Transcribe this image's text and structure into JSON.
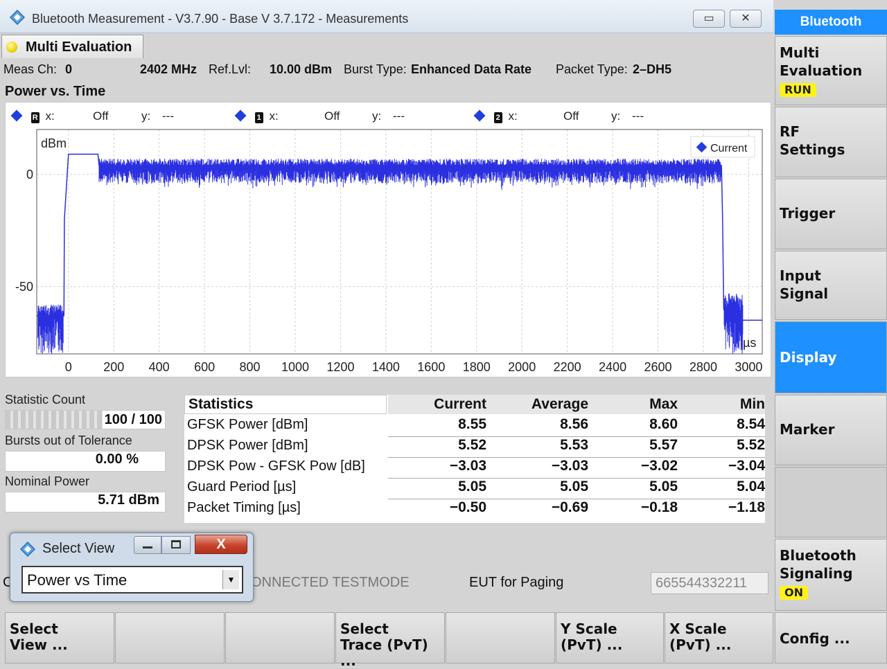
{
  "window": {
    "title": "Bluetooth Measurement  - V3.7.90 - Base V 3.7.172 - Measurements",
    "minimize": "▭",
    "close": "✕"
  },
  "tab": {
    "label": "Multi Evaluation"
  },
  "info": {
    "meas_ch_label": "Meas Ch:",
    "meas_ch": "0",
    "freq": "2402 MHz",
    "ref_lvl_label": "Ref.Lvl:",
    "ref_lvl": "10.00 dBm",
    "burst_label": "Burst Type:",
    "burst": "Enhanced Data Rate",
    "packet_label": "Packet Type:",
    "packet": "2–DH5"
  },
  "plot": {
    "title": "Power vs. Time",
    "markers": [
      {
        "id": "R",
        "x_label": "x:",
        "x": "Off",
        "y_label": "y:",
        "y": "---"
      },
      {
        "id": "1",
        "x_label": "x:",
        "x": "Off",
        "y_label": "y:",
        "y": "---"
      },
      {
        "id": "2",
        "x_label": "x:",
        "x": "Off",
        "y_label": "y:",
        "y": "---"
      }
    ],
    "legend": "Current",
    "ylabel": "dBm",
    "xunit": "µs"
  },
  "chart_data": {
    "type": "line",
    "ylabel": "dBm",
    "xlabel": "µs",
    "xlim": [
      -140,
      3060
    ],
    "ylim": [
      -80,
      20
    ],
    "x_ticks": [
      "0",
      "200",
      "400",
      "600",
      "800",
      "1000",
      "1200",
      "1400",
      "1600",
      "1800",
      "2000",
      "2200",
      "2400",
      "2600",
      "2800",
      "3000"
    ],
    "y_ticks": [
      "0",
      "-50"
    ],
    "series": [
      {
        "name": "Current",
        "x": [
          -140,
          -20,
          -18,
          0,
          2,
          130,
          135,
          2880,
          2885,
          2890,
          2900,
          2950,
          3060
        ],
        "y": [
          -63,
          -63,
          -20,
          9,
          9,
          9,
          4,
          4,
          -20,
          -60,
          -63,
          -65,
          -65
        ]
      }
    ]
  },
  "stats_left": {
    "statistic_count_label": "Statistic Count",
    "statistic_count": "100 / 100",
    "statistic_progress": 1.0,
    "bursts_label": "Bursts out of Tolerance",
    "bursts_value": "0.00  %",
    "nominal_label": "Nominal Power",
    "nominal_value": "5.71  dBm"
  },
  "stats_table": {
    "headers": [
      "Statistics",
      "Current",
      "Average",
      "Max",
      "Min"
    ],
    "rows": [
      {
        "label": "GFSK Power [dBm]",
        "values": [
          "8.55",
          "8.56",
          "8.60",
          "8.54"
        ]
      },
      {
        "label": "DPSK Power [dBm]",
        "values": [
          "5.52",
          "5.53",
          "5.57",
          "5.52"
        ]
      },
      {
        "label": "DPSK Pow - GFSK Pow [dB]",
        "values": [
          "−3.03",
          "−3.03",
          "−3.02",
          "−3.04"
        ]
      },
      {
        "label": "Guard Period [µs]",
        "values": [
          "5.05",
          "5.05",
          "5.05",
          "5.04"
        ]
      },
      {
        "label": "Packet Timing [µs]",
        "values": [
          "−0.50",
          "−0.69",
          "−0.18",
          "−1.18"
        ]
      }
    ]
  },
  "connection": {
    "partial_label": "C",
    "testmode": "ONNECTED TESTMODE",
    "eut_label": "EUT for Paging",
    "eut_value": "665544332211"
  },
  "select_view_dialog": {
    "title": "Select View",
    "close": "X",
    "selected": "Power vs Time"
  },
  "softkeys": [
    {
      "line1": "Select",
      "line2": "View ..."
    },
    {
      "line1": "",
      "line2": ""
    },
    {
      "line1": "",
      "line2": ""
    },
    {
      "line1": "Select",
      "line2": "Trace (PvT) ..."
    },
    {
      "line1": "",
      "line2": ""
    },
    {
      "line1": "Y Scale",
      "line2": "(PvT) ..."
    },
    {
      "line1": "X Scale",
      "line2": "(PvT) ..."
    }
  ],
  "right_panel": {
    "header": "Bluetooth",
    "multi_eval_line1": "Multi",
    "multi_eval_line2": "Evaluation",
    "multi_eval_badge": "RUN",
    "rf_line1": "RF",
    "rf_line2": "Settings",
    "trigger": "Trigger",
    "input_line1": "Input",
    "input_line2": "Signal",
    "display": "Display",
    "marker": "Marker",
    "bt_sig_line1": "Bluetooth",
    "bt_sig_line2": "Signaling",
    "bt_sig_badge": "ON",
    "config": "Config ..."
  },
  "colors": {
    "trace": "#2a2fe0",
    "accent": "#1e90ff",
    "badge": "#fff21b"
  }
}
